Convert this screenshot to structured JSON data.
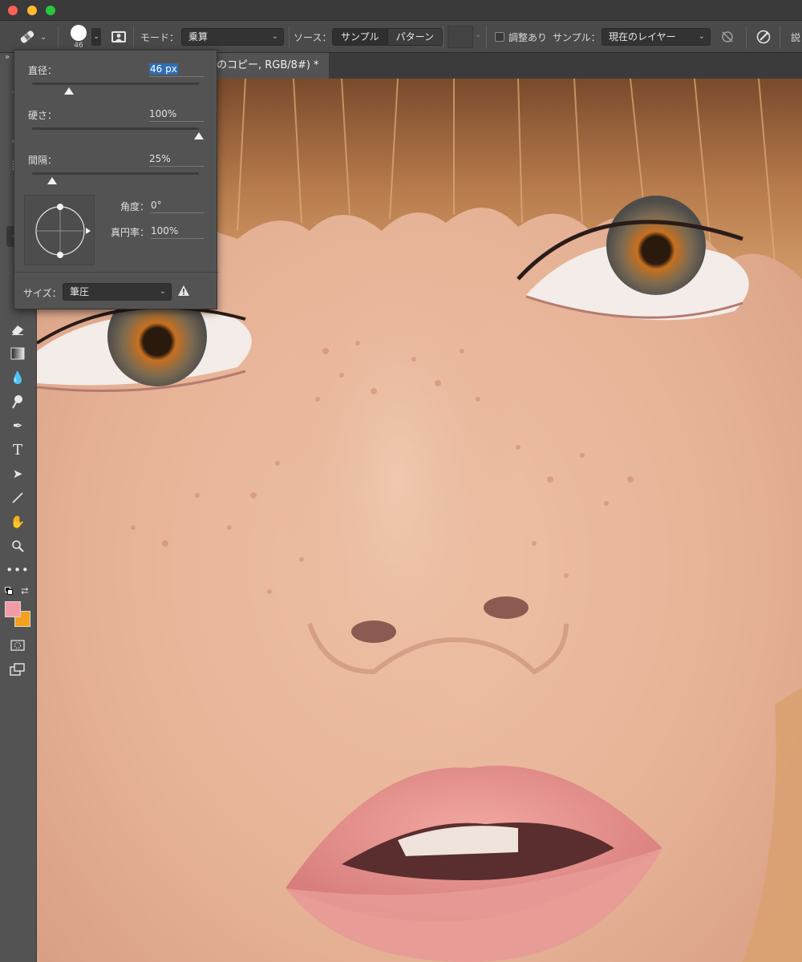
{
  "options_bar": {
    "brush_size_value": "46",
    "mode_label": "モード：",
    "mode_value": "乗算",
    "source_label": "ソース：",
    "source_options": [
      "サンプル",
      "パターン"
    ],
    "aligned_label": "調整あり",
    "sample_label": "サンプル：",
    "sample_value": "現在のレイヤー",
    "overflow_text": "説"
  },
  "document_tab": {
    "title": "のコピー, RGB/8#) *"
  },
  "brush_popup": {
    "diameter_label": "直径：",
    "diameter_value": "46 px",
    "hardness_label": "硬さ：",
    "hardness_value": "100%",
    "spacing_label": "間隔：",
    "spacing_value": "25%",
    "angle_label": "角度：",
    "angle_value": "0°",
    "roundness_label": "真円率：",
    "roundness_value": "100%",
    "size_label": "サイズ：",
    "size_value": "筆圧",
    "sliders": {
      "diameter": 0.22,
      "hardness": 1.0,
      "spacing": 0.12
    }
  },
  "colors": {
    "foreground": "#f29ba6",
    "background": "#f3a01e",
    "accent": "#2f6db5"
  },
  "icons": {
    "toolbar": [
      "healing-brush-icon",
      "brush-preset-icon",
      "clone-source-icon",
      "ignore-adjustment-icon",
      "pressure-icon"
    ],
    "tools": [
      "move-icon",
      "lasso-icon",
      "marquee-icon",
      "crop-icon",
      "healing-icon",
      "eraser-icon",
      "gradient-icon",
      "blur-icon",
      "dodge-icon",
      "pen-icon",
      "type-icon",
      "path-select-icon",
      "line-icon",
      "hand-icon",
      "zoom-icon",
      "more-icon",
      "swap-colors-icon",
      "quick-mask-icon",
      "screen-mode-icon"
    ]
  }
}
